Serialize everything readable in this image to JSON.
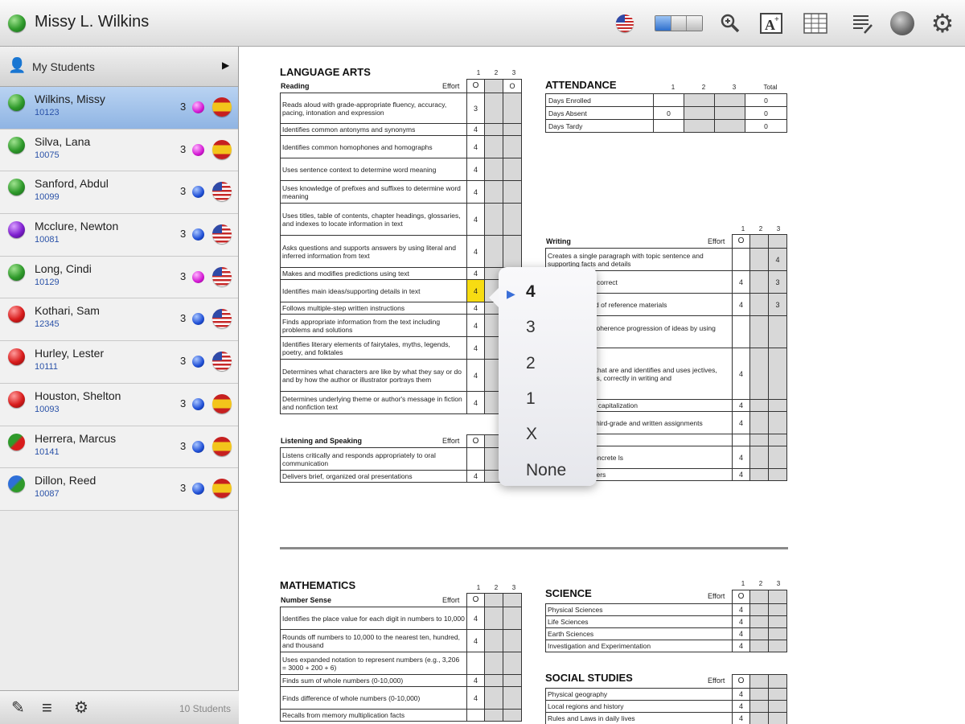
{
  "header": {
    "title": "Missy L. Wilkins"
  },
  "sidebar": {
    "title": "My Students",
    "students": [
      {
        "name": "Wilkins, Missy",
        "id": "10123",
        "level": "3"
      },
      {
        "name": "Silva, Lana",
        "id": "10075",
        "level": "3"
      },
      {
        "name": "Sanford, Abdul",
        "id": "10099",
        "level": "3"
      },
      {
        "name": "Mcclure, Newton",
        "id": "10081",
        "level": "3"
      },
      {
        "name": "Long, Cindi",
        "id": "10129",
        "level": "3"
      },
      {
        "name": "Kothari, Sam",
        "id": "12345",
        "level": "3"
      },
      {
        "name": "Hurley, Lester",
        "id": "10111",
        "level": "3"
      },
      {
        "name": "Houston, Shelton",
        "id": "10093",
        "level": "3"
      },
      {
        "name": "Herrera, Marcus",
        "id": "10141",
        "level": "3"
      },
      {
        "name": "Dillon, Reed",
        "id": "10087",
        "level": "3"
      }
    ],
    "footer_count": "10 Students"
  },
  "report": {
    "effort_label": "Effort",
    "quarters": [
      "1",
      "2",
      "3"
    ],
    "language_arts": {
      "title": "LANGUAGE ARTS",
      "reading": {
        "title": "Reading",
        "effort": "O",
        "effort_q3": "O",
        "items": [
          {
            "text": "Reads aloud with grade-appropriate fluency, accuracy, pacing, intonation and expression",
            "q1": "3"
          },
          {
            "text": "Identifies common antonyms and synonyms",
            "q1": "4"
          },
          {
            "text": "Identifies common homophones and homographs",
            "q1": "4"
          },
          {
            "text": "Uses sentence context to determine word meaning",
            "q1": "4"
          },
          {
            "text": "Uses knowledge of prefixes and suffixes to determine word meaning",
            "q1": "4"
          },
          {
            "text": "Uses titles, table of contents, chapter headings, glossaries, and indexes to locate information in text",
            "q1": "4"
          },
          {
            "text": "Asks questions and supports answers by using literal and inferred information from text",
            "q1": "4"
          },
          {
            "text": "Makes and modifies predictions using text",
            "q1": "4"
          },
          {
            "text": "Identifies main ideas/supporting details in text",
            "q1": "4"
          },
          {
            "text": "Follows multiple-step written instructions",
            "q1": "4"
          },
          {
            "text": "Finds appropriate information from the text including problems and solutions",
            "q1": "4"
          },
          {
            "text": "Identifies literary elements of fairytales, myths, legends, poetry, and folktales",
            "q1": "4"
          },
          {
            "text": "Determines what characters are like by what they say or do and by how the author or illustrator portrays them",
            "q1": "4"
          },
          {
            "text": "Determines underlying theme or author's message in fiction and nonfiction text",
            "q1": "4"
          }
        ]
      },
      "listening": {
        "title": "Listening and Speaking",
        "effort": "O",
        "items": [
          {
            "text": "Listens critically and responds appropriately to oral communication",
            "q1": ""
          },
          {
            "text": "Delivers brief, organized oral presentations",
            "q1": "4"
          }
        ]
      },
      "writing": {
        "title": "Writing",
        "effort": "O",
        "items": [
          {
            "text": "Creates a single paragraph with topic sentence and supporting facts and details",
            "q1": "",
            "q3": "4"
          },
          {
            "text": "in cursive using correct",
            "q1": "4",
            "q3": "3"
          },
          {
            "text": "the structure and of reference materials",
            "q1": "4",
            "q3": "3"
          },
          {
            "text": "to improve the coherence progression of ideas by using rubric",
            "q1": "",
            "q3": ""
          },
          {
            "text": "jects and verbs that are and identifies and uses jectives, compound words, correctly in writing and",
            "q1": "4",
            "q3": ""
          },
          {
            "text": "punctuation and capitalization",
            "q1": "4",
            "q3": ""
          },
          {
            "text": "accurately at a third-grade and written assignments",
            "q1": "4",
            "q3": ""
          },
          {
            "text": "ives",
            "q1": "",
            "q3": ""
          },
          {
            "text": "tions that use concrete ls",
            "q1": "4",
            "q3": ""
          },
          {
            "text": "y and formal letters",
            "q1": "4",
            "q3": ""
          }
        ]
      }
    },
    "attendance": {
      "title": "ATTENDANCE",
      "total_label": "Total",
      "rows": [
        {
          "label": "Days Enrolled",
          "q1": "",
          "total": "0"
        },
        {
          "label": "Days Absent",
          "q1": "0",
          "total": "0"
        },
        {
          "label": "Days Tardy",
          "q1": "",
          "total": "0"
        }
      ]
    },
    "mathematics": {
      "title": "MATHEMATICS",
      "sub": "Number Sense",
      "effort": "O",
      "items": [
        {
          "text": "Identifies the place value for each digit in numbers to 10,000",
          "q1": "4"
        },
        {
          "text": "Rounds off numbers to 10,000 to the nearest ten, hundred, and thousand",
          "q1": "4"
        },
        {
          "text": "Uses expanded notation to represent numbers (e.g., 3,206 = 3000 + 200 + 6)",
          "q1": ""
        },
        {
          "text": "Finds sum of whole numbers (0-10,000)",
          "q1": "4"
        },
        {
          "text": "Finds difference of whole numbers (0-10,000)",
          "q1": "4"
        },
        {
          "text": "Recalls from memory multiplication facts",
          "q1": ""
        }
      ]
    },
    "science": {
      "title": "SCIENCE",
      "effort": "O",
      "items": [
        {
          "text": "Physical Sciences",
          "q1": "4"
        },
        {
          "text": "Life Sciences",
          "q1": "4"
        },
        {
          "text": "Earth Sciences",
          "q1": "4"
        },
        {
          "text": "Investigation and Experimentation",
          "q1": "4"
        }
      ]
    },
    "social_studies": {
      "title": "SOCIAL STUDIES",
      "effort": "O",
      "items": [
        {
          "text": "Physical geography",
          "q1": "4"
        },
        {
          "text": "Local regions and history",
          "q1": "4"
        },
        {
          "text": "Rules and Laws in daily lives",
          "q1": "4"
        }
      ]
    }
  },
  "popover": {
    "selected": "4",
    "options": [
      "4",
      "3",
      "2",
      "1",
      "X",
      "None"
    ]
  }
}
